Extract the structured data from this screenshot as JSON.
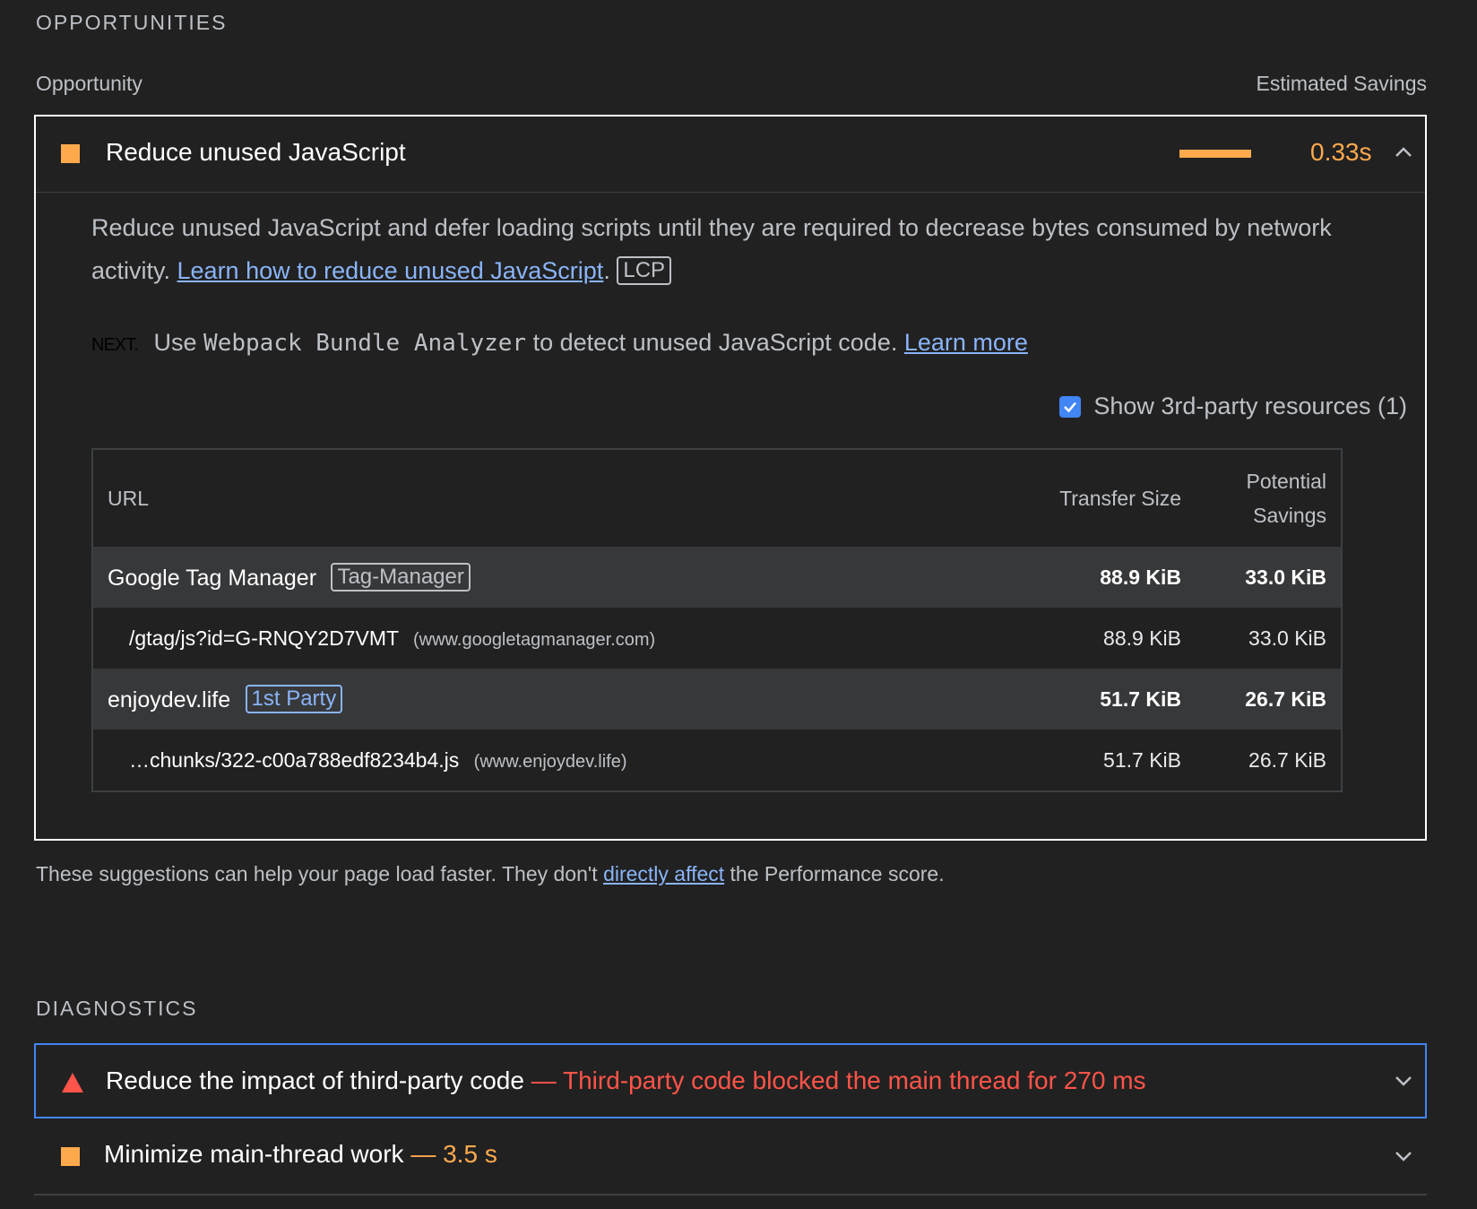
{
  "opportunities": {
    "section_title": "OPPORTUNITIES",
    "col_opportunity": "Opportunity",
    "col_savings": "Estimated Savings",
    "audit": {
      "title": "Reduce unused JavaScript",
      "savings": "0.33s",
      "description_text": "Reduce unused JavaScript and defer loading scripts until they are required to decrease bytes consumed by network activity. ",
      "learn_link": "Learn how to reduce unused JavaScript",
      "period": ".",
      "metric_tag": "LCP",
      "stack_logo": "NEXT.",
      "stack_pre": "Use ",
      "stack_code": "Webpack Bundle Analyzer",
      "stack_post": " to detect unused JavaScript code. ",
      "stack_link": "Learn more",
      "third_party_label": "Show 3rd-party resources (1)",
      "third_party_checked": true,
      "table": {
        "headers": {
          "url": "URL",
          "transfer": "Transfer Size",
          "savings_line1": "Potential",
          "savings_line2": "Savings"
        },
        "groups": [
          {
            "name": "Google Tag Manager",
            "tag": "Tag-Manager",
            "transfer": "88.9 KiB",
            "savings": "33.0 KiB",
            "item": {
              "url": "/gtag/js?id=G-RNQY2D7VMT",
              "host": "(www.googletagmanager.com)",
              "transfer": "88.9 KiB",
              "savings": "33.0 KiB"
            }
          },
          {
            "name": "enjoydev.life",
            "tag": "1st Party",
            "transfer": "51.7 KiB",
            "savings": "26.7 KiB",
            "item": {
              "url": "…chunks/322-c00a788edf8234b4.js",
              "host": "(www.enjoydev.life)",
              "transfer": "51.7 KiB",
              "savings": "26.7 KiB"
            }
          }
        ]
      }
    },
    "footer_pre": "These suggestions can help your page load faster. They don't ",
    "footer_link": "directly affect",
    "footer_post": " the Performance score."
  },
  "diagnostics": {
    "section_title": "DIAGNOSTICS",
    "items": [
      {
        "title": "Reduce the impact of third-party code",
        "dash": " — ",
        "detail": "Third-party code blocked the main thread for 270 ms",
        "severity": "fail"
      },
      {
        "title": "Minimize main-thread work",
        "dash": " — ",
        "detail": "3.5 s",
        "severity": "average"
      }
    ]
  },
  "colors": {
    "background": "#212121",
    "average": "#ffa94d",
    "fail": "#ff5449",
    "link": "#8ab4f8",
    "selection": "#4285f4"
  }
}
